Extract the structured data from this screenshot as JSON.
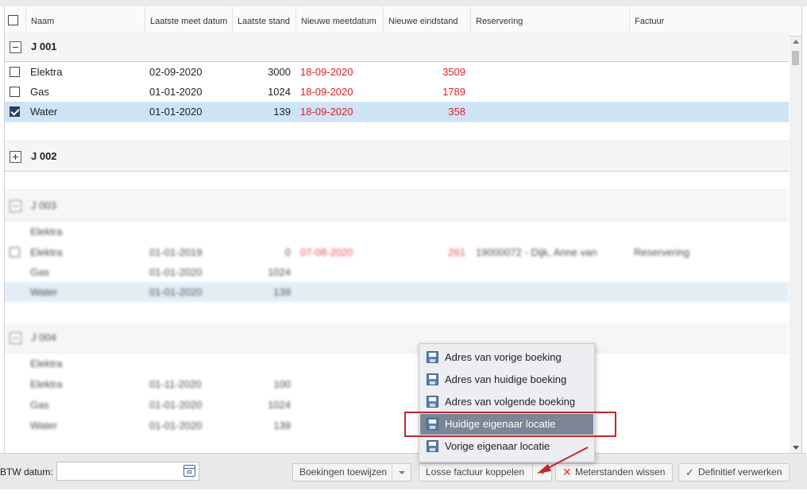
{
  "columns": [
    "Naam",
    "Laatste meet datum",
    "Laatste stand",
    "Nieuwe meetdatum",
    "Nieuwe eindstand",
    "Reservering",
    "Factuur"
  ],
  "groups": [
    {
      "label": "J 001",
      "rows": [
        {
          "naam": "Elektra",
          "laatste_datum": "02-09-2020",
          "laatste_stand": "3000",
          "nieuwe_datum": "18-09-2020",
          "nieuwe_stand": "3509",
          "checked": false
        },
        {
          "naam": "Gas",
          "laatste_datum": "01-01-2020",
          "laatste_stand": "1024",
          "nieuwe_datum": "18-09-2020",
          "nieuwe_stand": "1789",
          "checked": false
        },
        {
          "naam": "Water",
          "laatste_datum": "01-01-2020",
          "laatste_stand": "139",
          "nieuwe_datum": "18-09-2020",
          "nieuwe_stand": "358",
          "checked": true,
          "selected": true
        }
      ]
    },
    {
      "label": "J 002",
      "rows": []
    },
    {
      "label": "J 003",
      "rows": [
        {
          "naam": "Elektra"
        },
        {
          "naam": "Elektra",
          "laatste_datum": "01-01-2019",
          "laatste_stand": "0",
          "nieuwe_datum": "07-08-2020",
          "nieuwe_stand": "261",
          "reservering": "19000072 - Dijk, Anne van",
          "factuur": "Reservering"
        },
        {
          "naam": "Gas",
          "laatste_datum": "01-01-2020",
          "laatste_stand": "1024"
        },
        {
          "naam": "Water",
          "laatste_datum": "01-01-2020",
          "laatste_stand": "139"
        }
      ]
    },
    {
      "label": "J 004",
      "rows": [
        {
          "naam": "Elektra"
        },
        {
          "naam": "Elektra",
          "laatste_datum": "01-11-2020",
          "laatste_stand": "100"
        },
        {
          "naam": "Gas",
          "laatste_datum": "01-01-2020",
          "laatste_stand": "1024"
        },
        {
          "naam": "Water",
          "laatste_datum": "01-01-2020",
          "laatste_stand": "139"
        }
      ]
    }
  ],
  "menu": {
    "items": [
      "Adres van vorige boeking",
      "Adres van huidige boeking",
      "Adres van volgende boeking",
      "Huidige eigenaar locatie",
      "Vorige eigenaar locatie"
    ],
    "active_index": 3
  },
  "footer": {
    "btw_label": "BTW datum:",
    "btw_value": "",
    "btn_boekingen": "Boekingen toewijzen",
    "btn_losse": "Losse factuur koppelen",
    "btn_wissen": "Meterstanden wissen",
    "btn_definitief": "Definitief verwerken"
  },
  "colors": {
    "accent_red": "#e01e1e",
    "selected_row": "#cde4f6",
    "menu_active": "#7b8595",
    "highlight_box": "#c0272d"
  }
}
